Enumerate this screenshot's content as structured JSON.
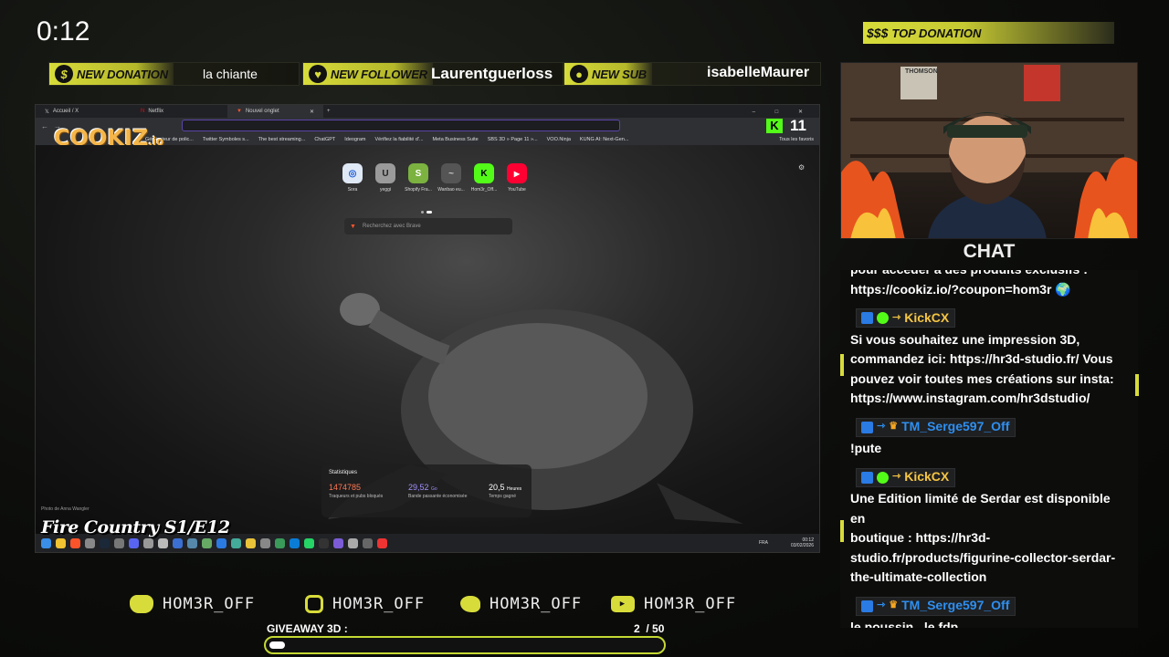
{
  "timer": "0:12",
  "alerts": {
    "donation_label": "NEW DONATION",
    "donation_value": "la chiante",
    "follower_label": "NEW FOLLOWER",
    "follower_value": "Laurentguerloss",
    "sub_label": "NEW SUB",
    "sub_value": "isabelleMaurer"
  },
  "top_donation": {
    "icon": "$$$",
    "label": "TOP DONATION"
  },
  "browser": {
    "tabs": [
      "Accueil / X",
      "Netflix",
      "Nouvel onglet"
    ],
    "logo": "COOKIZ",
    "logo_suffix": ".io",
    "kick_count": "11",
    "bookmarks": [
      "Générateur de polic...",
      "Twitter Symboles s...",
      "The best streaming...",
      "ChatGPT",
      "Ideogram",
      "Vérifiez la fiabilité d'...",
      "Meta Business Suite",
      "SBS 3D » Page 11 »...",
      "VOO.Ninja",
      "KUNG AI: Next-Gen..."
    ],
    "all_favorites": "Tous les favoris",
    "tiles": [
      {
        "label": "Sora",
        "glyph": "◎",
        "color": "#dfe8f5"
      },
      {
        "label": "yeggi",
        "glyph": "U",
        "color": "#9a9a9a"
      },
      {
        "label": "Shopify Fra...",
        "glyph": "S",
        "color": "#7bb240"
      },
      {
        "label": "Wanbao eu...",
        "glyph": "~",
        "color": "#555555"
      },
      {
        "label": "Hom3r_Off...",
        "glyph": "K",
        "color": "#53fc18"
      },
      {
        "label": "YouTube",
        "glyph": "▶",
        "color": "#ff0033"
      }
    ],
    "search_placeholder": "Recherchez avec Brave",
    "photo_credit": "Photo de Anna Wangler",
    "stats": {
      "title": "Statistiques",
      "trackers_value": "1474785",
      "trackers_label": "Traqueurs et pubs bloqués",
      "bandwidth_value": "29,52",
      "bandwidth_unit": "Go",
      "bandwidth_label": "Bande passante économisée",
      "time_value": "20,5",
      "time_unit": "Heures",
      "time_label": "Temps gagné"
    },
    "taskbar_lang": "FRA",
    "taskbar_time": "00:12",
    "taskbar_date": "03/02/2026"
  },
  "episode_title": "Fire Country S1/E12",
  "cam_poster_text": "THOMSON",
  "chat": {
    "title": "CHAT",
    "messages": [
      {
        "user": null,
        "text_lines": [
          "pour accéder à des produits exclusifs :",
          "https://cookiz.io/?coupon=hom3r 🌍"
        ]
      },
      {
        "user": "KickCX",
        "user_color": "#f5c542",
        "text_lines": [
          "Si vous souhaitez une impression 3D,",
          "commandez ici: https://hr3d-studio.fr/ Vous",
          "pouvez voir toutes mes créations sur insta:",
          "https://www.instagram.com/hr3dstudio/"
        ]
      },
      {
        "user": "TM_Serge597_Off",
        "user_color": "#2e8ff0",
        "text_lines": [
          "!pute"
        ]
      },
      {
        "user": "KickCX",
        "user_color": "#f5c542",
        "text_lines": [
          "Une Edition limité de Serdar est disponible en",
          "boutique : https://hr3d-",
          "studio.fr/products/figurine-collector-serdar-",
          "the-ultimate-collection"
        ]
      },
      {
        "user": "TM_Serge597_Off",
        "user_color": "#2e8ff0",
        "text_lines": [
          "le poussin , le fdp"
        ]
      }
    ]
  },
  "socials": [
    {
      "icon": "discord-icon",
      "handle": "HOM3R_OFF"
    },
    {
      "icon": "instagram-icon",
      "handle": "HOM3R_OFF"
    },
    {
      "icon": "twitter-icon",
      "handle": "HOM3R_OFF"
    },
    {
      "icon": "youtube-icon",
      "handle": "HOM3R_OFF"
    }
  ],
  "giveaway": {
    "label": "GIVEAWAY 3D :",
    "current": "2",
    "total": "/ 50",
    "fraction": 0.04
  },
  "colors": {
    "accent": "#d8dc3a",
    "progress_border": "#c5d933",
    "kick_green": "#53fc18"
  }
}
